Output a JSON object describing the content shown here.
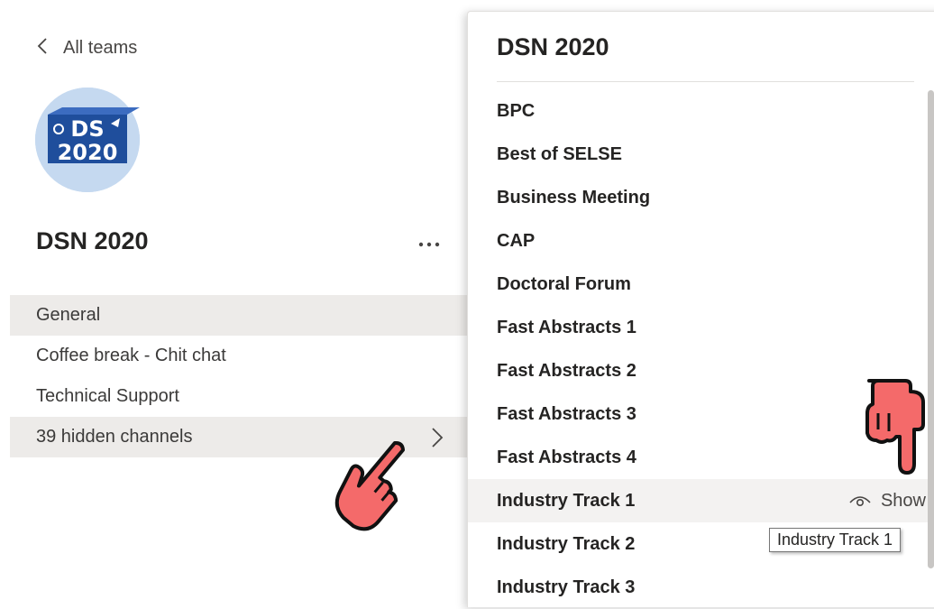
{
  "back": {
    "label": "All teams",
    "icon": "chevron-left-icon"
  },
  "team": {
    "name": "DSN 2020",
    "logo_text": [
      "DS",
      "2020"
    ],
    "more_icon": "more-options-icon",
    "avatar_color": "#c5d9f0"
  },
  "channels": [
    {
      "label": "General",
      "selected": true
    },
    {
      "label": "Coffee break - Chit chat",
      "selected": false
    },
    {
      "label": "Technical Support",
      "selected": false
    }
  ],
  "hidden_channels": {
    "label": "39 hidden channels",
    "icon": "chevron-right-icon"
  },
  "panel": {
    "title": "DSN 2020",
    "items": [
      {
        "label": "BPC"
      },
      {
        "label": "Best of SELSE"
      },
      {
        "label": "Business Meeting"
      },
      {
        "label": "CAP"
      },
      {
        "label": "Doctoral Forum"
      },
      {
        "label": "Fast Abstracts 1"
      },
      {
        "label": "Fast Abstracts 2"
      },
      {
        "label": "Fast Abstracts 3"
      },
      {
        "label": "Fast Abstracts 4"
      },
      {
        "label": "Industry Track 1",
        "show_label": "Show",
        "highlighted": true
      },
      {
        "label": "Industry Track 2"
      },
      {
        "label": "Industry Track 3"
      }
    ]
  },
  "tooltip": {
    "text": "Industry Track 1"
  },
  "colors": {
    "accent_hand": "#f46a6a",
    "hover_bg": "#edebe9"
  }
}
